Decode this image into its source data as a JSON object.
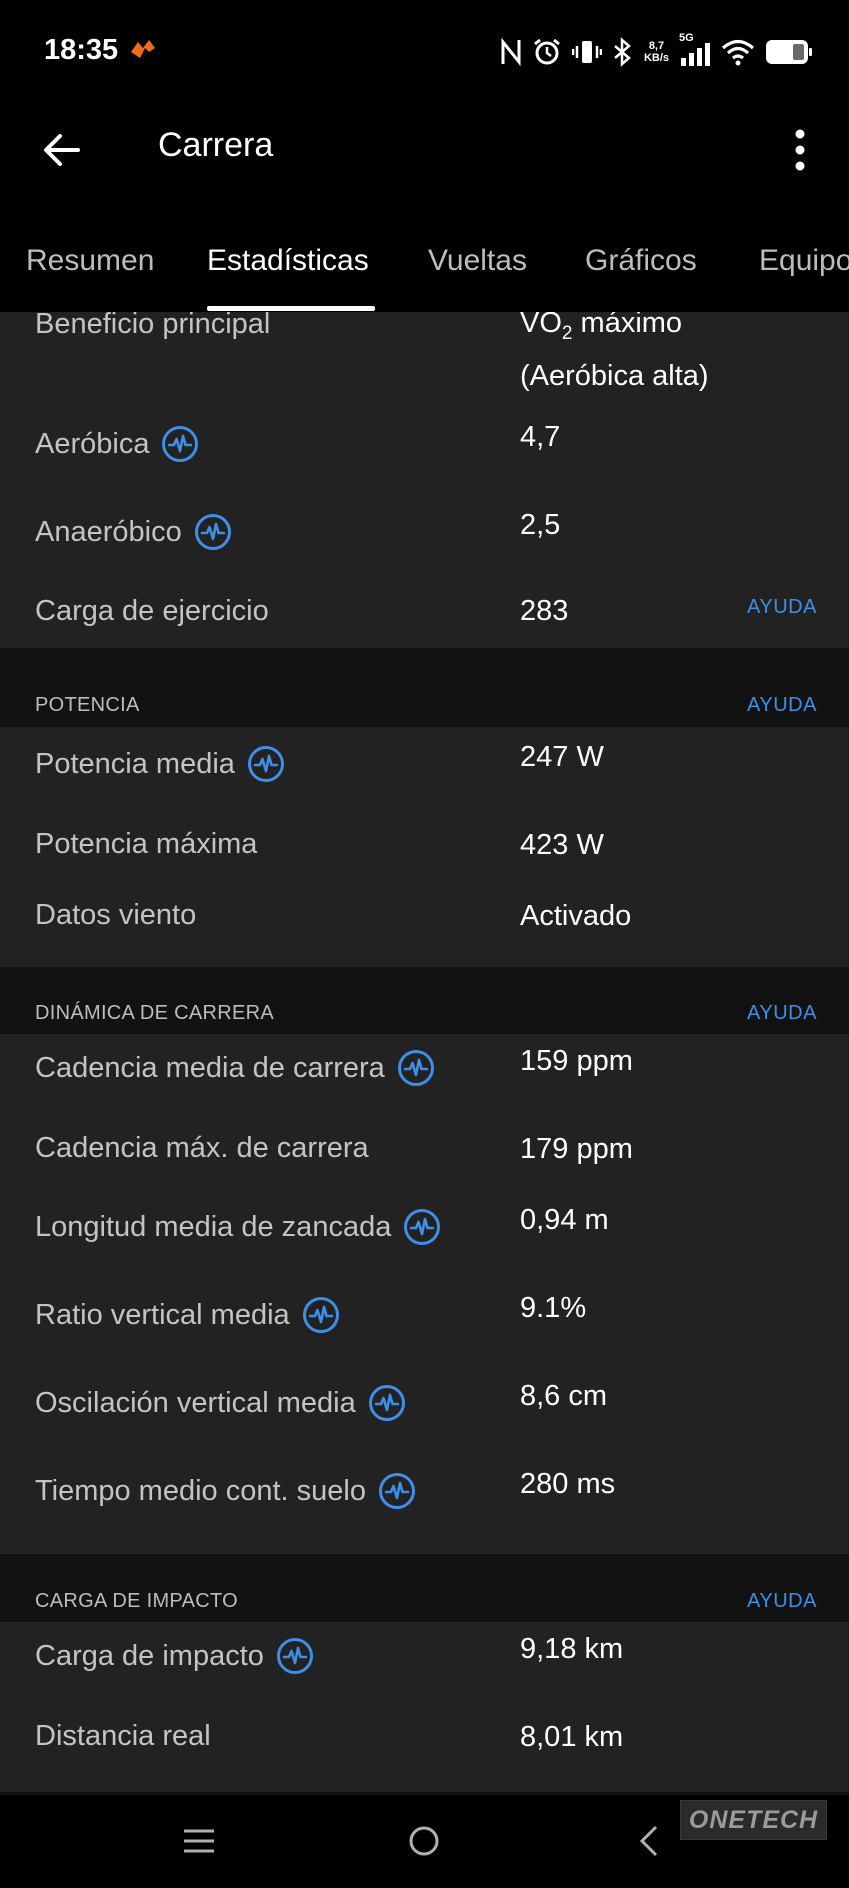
{
  "status": {
    "time": "18:35",
    "net_speed_value": "8,7",
    "net_speed_unit": "KB/s",
    "network": "5G"
  },
  "header": {
    "title": "Carrera"
  },
  "tabs": [
    {
      "label": "Resumen"
    },
    {
      "label": "Estadísticas"
    },
    {
      "label": "Vueltas"
    },
    {
      "label": "Gráficos"
    },
    {
      "label": "Equipo"
    }
  ],
  "training": {
    "rows": [
      {
        "label": "Beneficio principal",
        "value_line1_pre": "VO",
        "value_line1_sub": "2",
        "value_line1_post": " máximo",
        "value_line2": "(Aeróbica alta)"
      },
      {
        "label": "Aeróbica",
        "value": "4,7"
      },
      {
        "label": "Anaeróbico",
        "value": "2,5"
      },
      {
        "label": "Carga de ejercicio",
        "value": "283"
      }
    ],
    "help": "AYUDA"
  },
  "potencia": {
    "header": "POTENCIA",
    "help": "AYUDA",
    "rows": [
      {
        "label": "Potencia media",
        "value": "247 W"
      },
      {
        "label": "Potencia máxima",
        "value": "423 W"
      },
      {
        "label": "Datos viento",
        "value": "Activado"
      }
    ]
  },
  "dinamica": {
    "header": "DINÁMICA DE CARRERA",
    "help": "AYUDA",
    "rows": [
      {
        "label": "Cadencia media de carrera",
        "value": "159 ppm"
      },
      {
        "label": "Cadencia máx. de carrera",
        "value": "179 ppm"
      },
      {
        "label": "Longitud media de zancada",
        "value": "0,94 m"
      },
      {
        "label": "Ratio vertical media",
        "value": "9.1%"
      },
      {
        "label": "Oscilación vertical media",
        "value": "8,6 cm"
      },
      {
        "label": "Tiempo medio cont. suelo",
        "value": "280 ms"
      }
    ]
  },
  "impacto": {
    "header": "CARGA DE IMPACTO",
    "help": "AYUDA",
    "rows": [
      {
        "label": "Carga de impacto",
        "value": "9,18 km"
      },
      {
        "label": "Distancia real",
        "value": "8,01 km"
      }
    ]
  },
  "watermark": "ONETECH",
  "colors": {
    "accent": "#3d8fe8",
    "card": "#222222",
    "section_bg": "#121212"
  }
}
